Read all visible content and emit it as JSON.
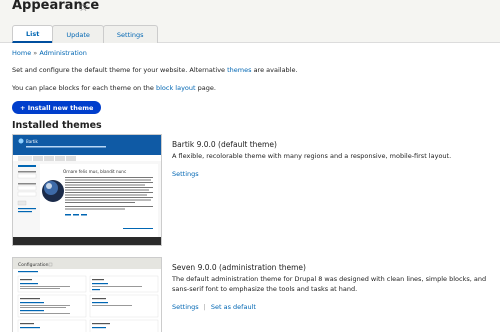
{
  "header": {
    "title": "Appearance",
    "tabs": [
      {
        "label": "List"
      },
      {
        "label": "Update"
      },
      {
        "label": "Settings"
      }
    ]
  },
  "breadcrumb": {
    "home": "Home",
    "separator": "»",
    "admin": "Administration"
  },
  "intro": {
    "before": "Set and configure the default theme for your website. Alternative ",
    "link": "themes",
    "after": " are available."
  },
  "blocks": {
    "before": "You can place blocks for each theme on the ",
    "link": "block layout",
    "after": " page."
  },
  "install_button": "+ Install new theme",
  "installed_heading": "Installed themes",
  "themes": [
    {
      "name": "Bartik 9.0.0 (default theme)",
      "description": "A flexible, recolorable theme with many regions and a responsive, mobile-first layout.",
      "links": [
        "Settings"
      ]
    },
    {
      "name": "Seven 9.0.0 (administration theme)",
      "description": "The default administration theme for Drupal 8 was designed with clean lines, simple blocks, and sans-serif font to emphasize the tools and tasks at hand.",
      "links": [
        "Settings",
        "Set as default"
      ]
    }
  ],
  "bartik_shot": {
    "site_name": "Bartik",
    "headline": "Ornare felis mus, blandit nunc"
  },
  "seven_shot": {
    "heading": "Configuration"
  },
  "colors": {
    "link": "#0066b3",
    "button": "#003ecc",
    "bartik_header": "#0f5aa5",
    "seven_header": "#e5e5e0"
  }
}
